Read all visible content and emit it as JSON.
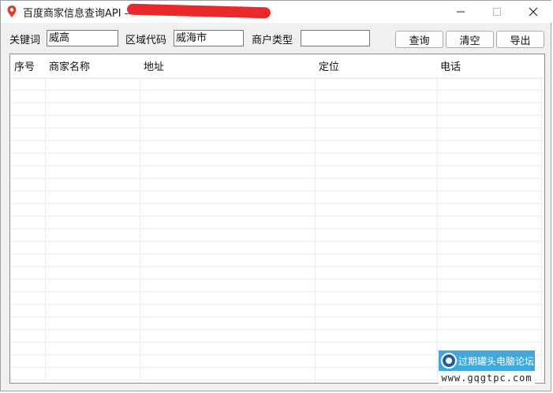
{
  "window": {
    "title": "百度商家信息查询API ---",
    "controls": {
      "minimize": "—",
      "maximize": "□",
      "close": "✕"
    }
  },
  "form": {
    "keyword_label": "关键词",
    "keyword_value": "威高",
    "region_label": "区域代码",
    "region_value": "威海市",
    "type_label": "商户类型",
    "type_value": "",
    "query_button": "查询",
    "clear_button": "清空",
    "export_button": "导出"
  },
  "table": {
    "columns": [
      "序号",
      "商家名称",
      "地址",
      "定位",
      "电话"
    ],
    "rows": []
  },
  "watermark": {
    "label": "过期罐头电脑论坛",
    "url": "www.gqgtpc.com"
  },
  "colors": {
    "titlebar": "#ffffff",
    "window_bg": "#f0f0f0",
    "redaction": "#ea2a2a",
    "watermark_bg": "#3fa9d9"
  }
}
